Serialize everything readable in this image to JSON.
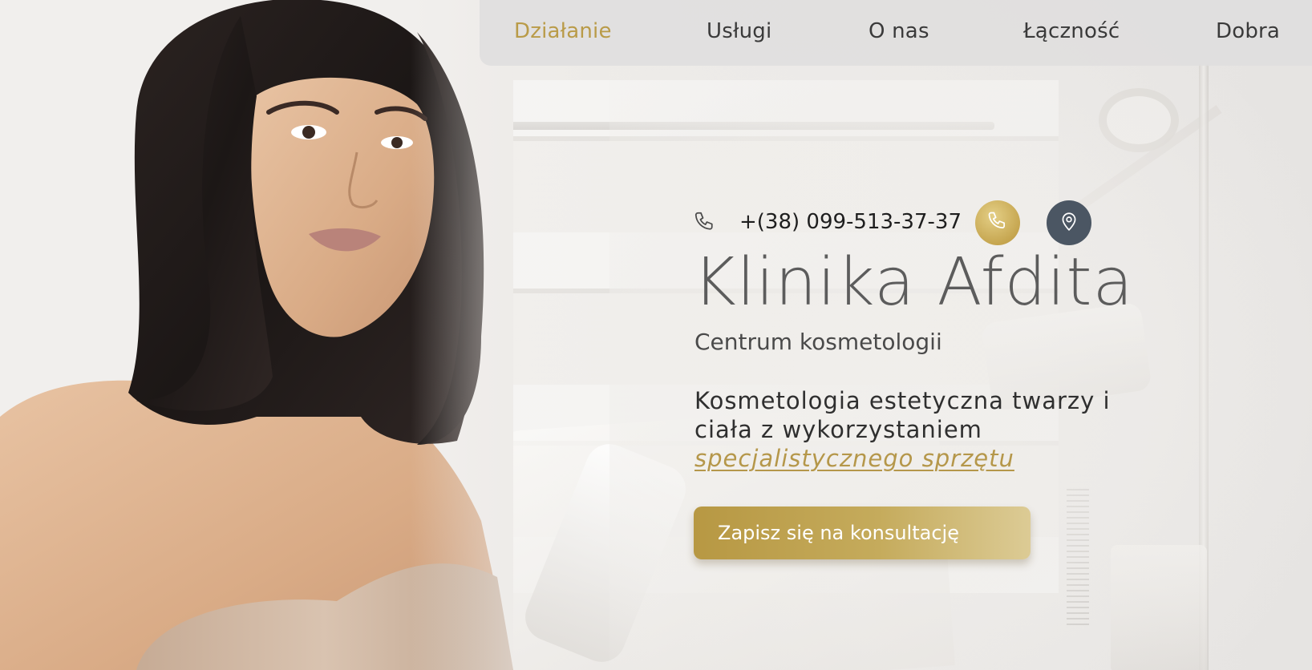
{
  "nav": {
    "items": [
      {
        "label": "Działanie",
        "active": true
      },
      {
        "label": "Usługi",
        "active": false
      },
      {
        "label": "O nas",
        "active": false
      },
      {
        "label": "Łączność",
        "active": false
      },
      {
        "label": "Dobra",
        "active": false
      }
    ]
  },
  "contact": {
    "phone": "+(38) 099-513-37-37",
    "phone_icon": "phone-icon",
    "call_button_icon": "phone-icon",
    "map_button_icon": "map-pin-icon"
  },
  "hero": {
    "title": "Klinika Afdita",
    "subtitle": "Centrum kosmetologii",
    "description_prefix": "Kosmetologia estetyczna twarzy i ciała z wykorzystaniem ",
    "description_highlight": "specjalistycznego sprzętu",
    "cta_label": "Zapisz się na konsultację"
  },
  "colors": {
    "accent_gold": "#b99b48",
    "map_button": "#4b5663",
    "nav_background": "#e0dede",
    "text_dark": "#2f2f2f"
  }
}
